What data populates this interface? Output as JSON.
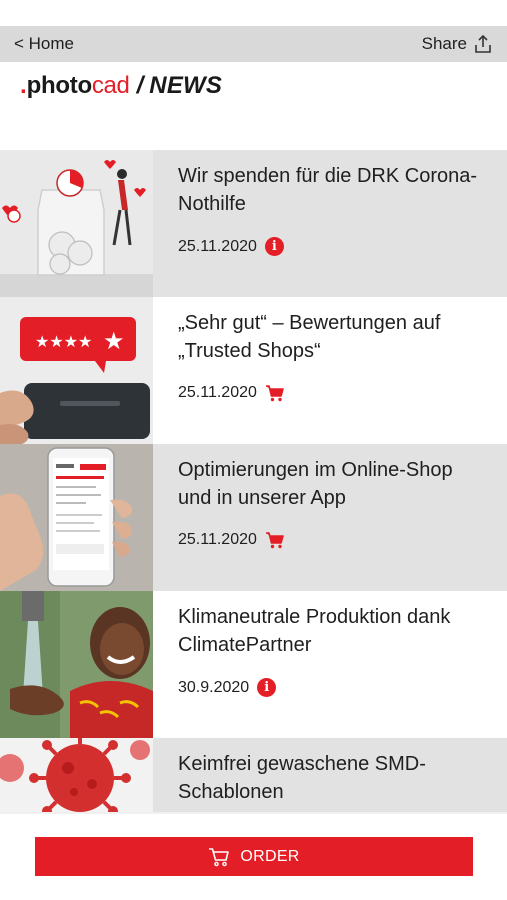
{
  "nav": {
    "back_label": "< Home",
    "share_label": "Share"
  },
  "brand": {
    "dot": ".",
    "photo": "photo",
    "cad": "cad",
    "separator": "/",
    "section": "NEWS"
  },
  "colors": {
    "accent": "#e41e26",
    "navbar": "#d9d9d9",
    "item_gray": "#e2e2e2"
  },
  "news": [
    {
      "title": "Wir spenden für die DRK Corona-Nothilfe",
      "date": "25.11.2020",
      "category_icon": "info-icon"
    },
    {
      "title": "„Sehr gut“ – Bewertungen auf „Trusted Shops“",
      "date": "25.11.2020",
      "category_icon": "cart-icon"
    },
    {
      "title": "Optimierungen im Online-Shop und in unserer App",
      "date": "25.11.2020",
      "category_icon": "cart-icon"
    },
    {
      "title": "Klimaneutrale Produktion dank ClimatePartner",
      "date": "30.9.2020",
      "category_icon": "info-icon"
    },
    {
      "title": "Keimfrei gewaschene SMD-Schablonen",
      "date": "",
      "category_icon": ""
    }
  ],
  "footer": {
    "order_label": "ORDER"
  }
}
